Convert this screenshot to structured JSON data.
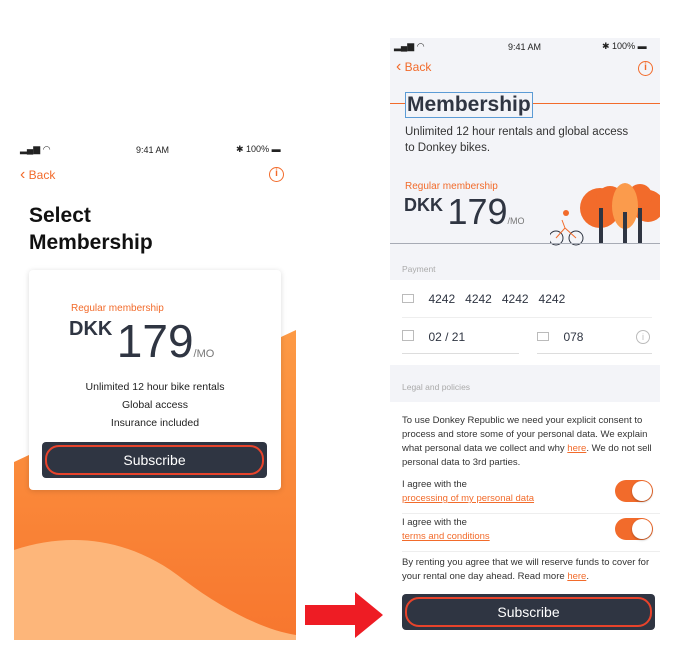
{
  "status": {
    "time": "9:41 AM",
    "battery": "100%"
  },
  "left": {
    "back": "Back",
    "title_line1": "Select",
    "title_line2": "Membership",
    "plan_label": "Regular membership",
    "currency": "DKK",
    "price": "179",
    "period": "/MO",
    "features": [
      "Unlimited 12 hour bike rentals",
      "Global access",
      "Insurance included"
    ],
    "subscribe": "Subscribe"
  },
  "right": {
    "back": "Back",
    "title": "Membership",
    "description": "Unlimited 12 hour rentals and global access to Donkey bikes.",
    "plan_label": "Regular membership",
    "currency": "DKK",
    "price": "179",
    "period": "/MO",
    "payment_header": "Payment",
    "card_number": "4242   4242   4242   4242",
    "expiry": "02 / 21",
    "cvc": "078",
    "legal_header": "Legal and policies",
    "consent_text": "To use Donkey Republic we need your explicit consent to process and store some of your personal data. We explain what personal data we collect and why ",
    "consent_link": "here",
    "consent_tail": ". We do not sell personal data to 3rd parties.",
    "agree1_prefix": "I agree with the",
    "agree1_link": "processing of my personal data",
    "agree2_prefix": "I agree with the",
    "agree2_link": "terms and conditions",
    "toggle1_on": true,
    "toggle2_on": true,
    "funds_text": "By renting you agree that we will reserve funds to cover for your rental one day ahead. Read more ",
    "funds_link": "here",
    "funds_tail": ".",
    "subscribe": "Subscribe"
  },
  "colors": {
    "accent": "#f26b2b",
    "dark": "#2f3542",
    "highlight": "#e8432b"
  }
}
